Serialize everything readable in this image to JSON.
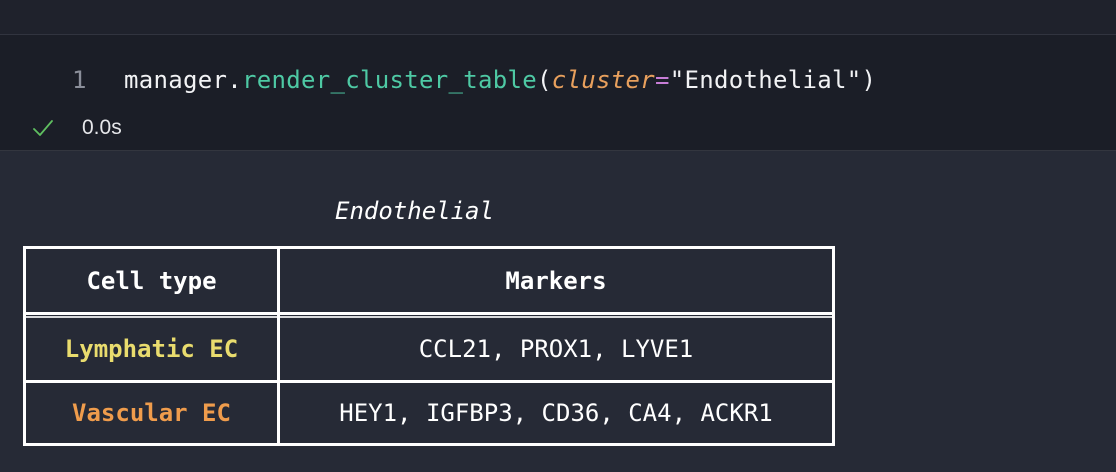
{
  "code_cell": {
    "line_number": "1",
    "code": {
      "object": "manager",
      "dot": ".",
      "function": "render_cluster_table",
      "open_paren": "(",
      "param": "cluster",
      "equals": "=",
      "string": "\"Endothelial\"",
      "close_paren": ")"
    },
    "status": {
      "icon": "check-icon",
      "duration": "0.0s",
      "color": "#5fbf60"
    }
  },
  "output": {
    "title": "Endothelial",
    "headers": [
      "Cell type",
      "Markers"
    ],
    "rows": [
      {
        "cell_type": "Lymphatic EC",
        "markers": "CCL21, PROX1, LYVE1",
        "color": "#e9dc6e"
      },
      {
        "cell_type": "Vascular EC",
        "markers": "HEY1, IGFBP3, CD36, CA4, ACKR1",
        "color": "#ef9c4c"
      }
    ]
  }
}
